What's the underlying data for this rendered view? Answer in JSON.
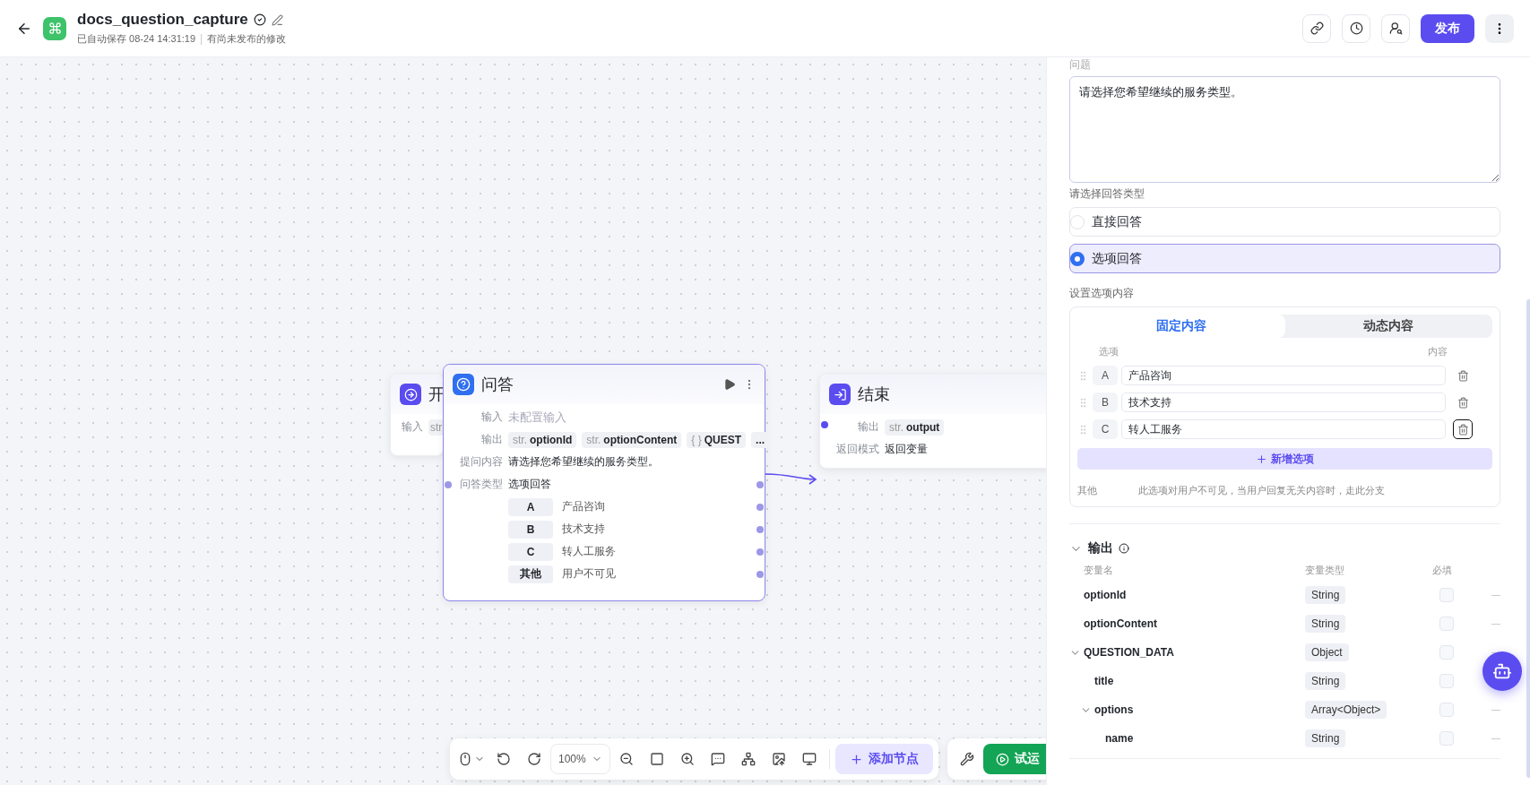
{
  "header": {
    "title": "docs_question_capture",
    "autosave": "已自动保存 08-24 14:31:19",
    "status": "有尚未发布的修改",
    "publish": "发布"
  },
  "start_node": {
    "title": "开",
    "input_label": "输入",
    "chip": "str"
  },
  "qa_node": {
    "title": "问答",
    "input_label": "输入",
    "input_value": "未配置输入",
    "output_label": "输出",
    "outputs": [
      {
        "type": "str.",
        "name": "optionId"
      },
      {
        "type": "str.",
        "name": "optionContent"
      },
      {
        "type": "{ }",
        "name": "QUEST"
      }
    ],
    "more": "...",
    "question_label": "提问内容",
    "question": "请选择您希望继续的服务类型。",
    "answer_type_label": "问答类型",
    "answer_type": "选项回答",
    "options": [
      {
        "key": "A",
        "text": "产品咨询"
      },
      {
        "key": "B",
        "text": "技术支持"
      },
      {
        "key": "C",
        "text": "转人工服务"
      },
      {
        "key": "其他",
        "text": "用户不可见"
      }
    ]
  },
  "end_node": {
    "title": "结束",
    "output_label": "输出",
    "output": {
      "type": "str.",
      "name": "output"
    },
    "mode_label": "返回模式",
    "mode": "返回变量"
  },
  "toolbar": {
    "zoom": "100%",
    "add_node": "添加节点",
    "run": "试运"
  },
  "panel": {
    "question_label": "问题",
    "question": "请选择您希望继续的服务类型。",
    "answer_type_label": "请选择回答类型",
    "answer_types": [
      {
        "label": "直接回答",
        "selected": false
      },
      {
        "label": "选项回答",
        "selected": true
      }
    ],
    "options_label": "设置选项内容",
    "tabs": [
      {
        "label": "固定内容",
        "selected": true
      },
      {
        "label": "动态内容",
        "selected": false
      }
    ],
    "options_header": [
      "选项",
      "内容"
    ],
    "options": [
      {
        "key": "A",
        "value": "产品咨询"
      },
      {
        "key": "B",
        "value": "技术支持"
      },
      {
        "key": "C",
        "value": "转人工服务"
      }
    ],
    "add_option": "新增选项",
    "other_label": "其他",
    "other_note": "此选项对用户不可见，当用户回复无关内容时，走此分支"
  },
  "output": {
    "title": "输出",
    "columns": [
      "变量名",
      "变量类型",
      "必填"
    ],
    "rows": [
      {
        "name": "optionId",
        "type": "String",
        "required": false
      },
      {
        "name": "optionContent",
        "type": "String",
        "required": false
      },
      {
        "name": "QUESTION_DATA",
        "type": "Object",
        "required": false,
        "children": [
          {
            "name": "title",
            "type": "String",
            "required": false
          },
          {
            "name": "options",
            "type": "Array<Object>",
            "required": false,
            "children": [
              {
                "name": "name",
                "type": "String",
                "required": false
              }
            ]
          }
        ]
      }
    ]
  }
}
